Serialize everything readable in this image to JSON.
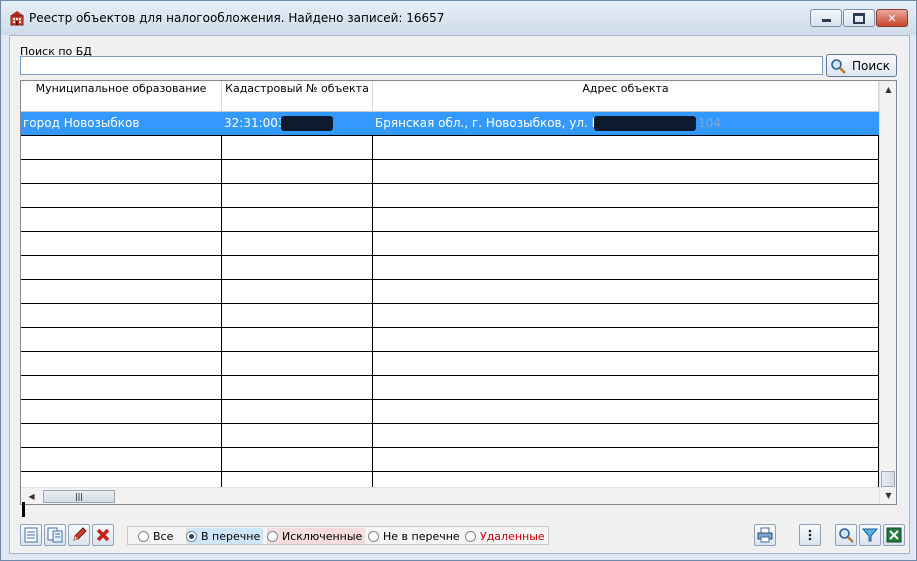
{
  "window": {
    "title": "Реестр объектов для налогообложения. Найдено записей: 16657",
    "icons": [
      "building-icon",
      "minimize-icon",
      "maximize-icon",
      "close-icon"
    ]
  },
  "search": {
    "label": "Поиск по БД",
    "value": "",
    "button_label": "Поиск"
  },
  "grid": {
    "columns": [
      "Муниципальное образование",
      "Кадастровый № объекта",
      "Адрес объекта"
    ],
    "rows": [
      [
        "город Новозыбков",
        "32:31:0030",
        "Брянская обл., г. Новозыбков, ул. Комм"
      ],
      [
        "",
        "",
        ""
      ],
      [
        "",
        "",
        ""
      ],
      [
        "",
        "",
        ""
      ],
      [
        "",
        "",
        ""
      ],
      [
        "",
        "",
        ""
      ],
      [
        "",
        "",
        ""
      ],
      [
        "",
        "",
        ""
      ],
      [
        "",
        "",
        ""
      ],
      [
        "",
        "",
        ""
      ],
      [
        "",
        "",
        ""
      ],
      [
        "",
        "",
        ""
      ],
      [
        "",
        "",
        ""
      ],
      [
        "",
        "",
        ""
      ],
      [
        "",
        "",
        ""
      ],
      [
        "",
        "",
        ""
      ]
    ],
    "selected_row": 0,
    "row_fragment_after_redaction": "104"
  },
  "filter": {
    "options": [
      "Все",
      "В перечне",
      "Исключенные",
      "Не в перечне",
      "Удаленные"
    ],
    "selected": "В перечне",
    "colors": {
      "selected_bg": "#cfe5f9",
      "excluded_bg": "#f6dcdc",
      "deleted_text": "#cc0000"
    }
  },
  "colors": {
    "selection": "#3399ff",
    "client_bg": "#f0f0f0",
    "titlebar_top": "#e7eff8",
    "titlebar_bottom": "#cfdbe9"
  },
  "toolbar_icons": {
    "left": [
      "list-view-icon",
      "details-view-icon",
      "edit-icon",
      "delete-icon"
    ],
    "right": [
      "print-icon",
      "more-options-icon",
      "zoom-search-icon",
      "filter-icon",
      "excel-export-icon"
    ]
  }
}
